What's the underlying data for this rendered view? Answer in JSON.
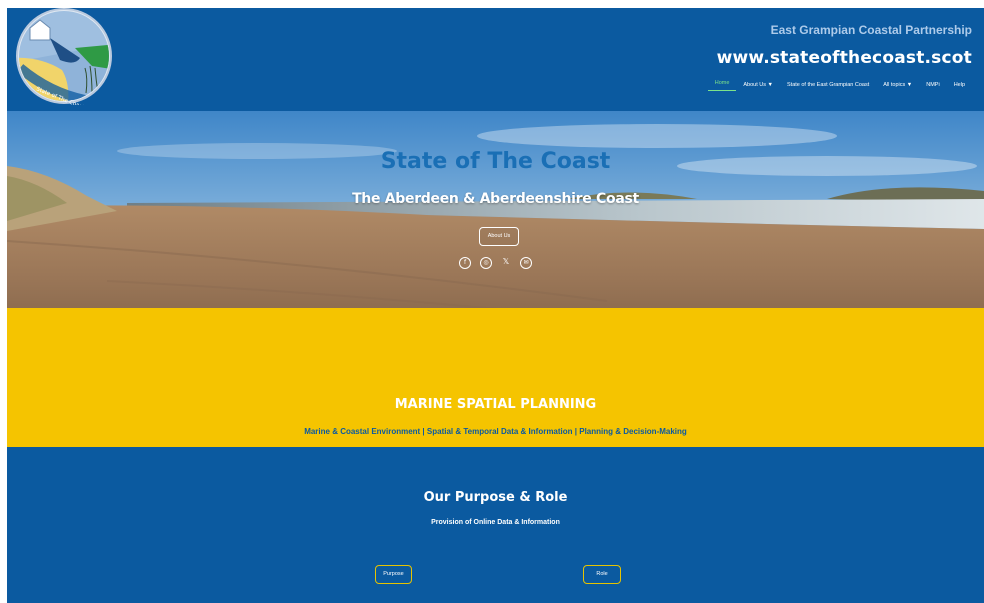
{
  "header": {
    "org_name": "East Grampian Coastal Partnership",
    "site_url": "www.stateofthecoast.scot",
    "logo_text": "State of The Coast",
    "nav": [
      {
        "label": "Home",
        "active": true
      },
      {
        "label": "About Us ▼",
        "active": false
      },
      {
        "label": "State of the East Grampian Coast",
        "active": false
      },
      {
        "label": "All topics ▼",
        "active": false
      },
      {
        "label": "NMPi",
        "active": false
      },
      {
        "label": "Help",
        "active": false
      }
    ]
  },
  "hero": {
    "title": "State of The Coast",
    "subtitle": "The Aberdeen & Aberdeenshire Coast",
    "about_button": "About Us",
    "socials": [
      "facebook-icon",
      "instagram-icon",
      "x-icon",
      "email-icon"
    ]
  },
  "band": {
    "title": "MARINE SPATIAL PLANNING",
    "topics": "Marine & Coastal Environment | Spatial & Temporal Data & Information | Planning & Decision-Making"
  },
  "purpose": {
    "title": "Our Purpose & Role",
    "subtitle": "Provision of Online Data & Information",
    "purpose_button": "Purpose",
    "role_button": "Role"
  },
  "colors": {
    "brand_blue": "#0b5aa0",
    "band_yellow": "#f5c400",
    "nav_active": "#7be38a",
    "title_blue": "#1a6fb5"
  }
}
